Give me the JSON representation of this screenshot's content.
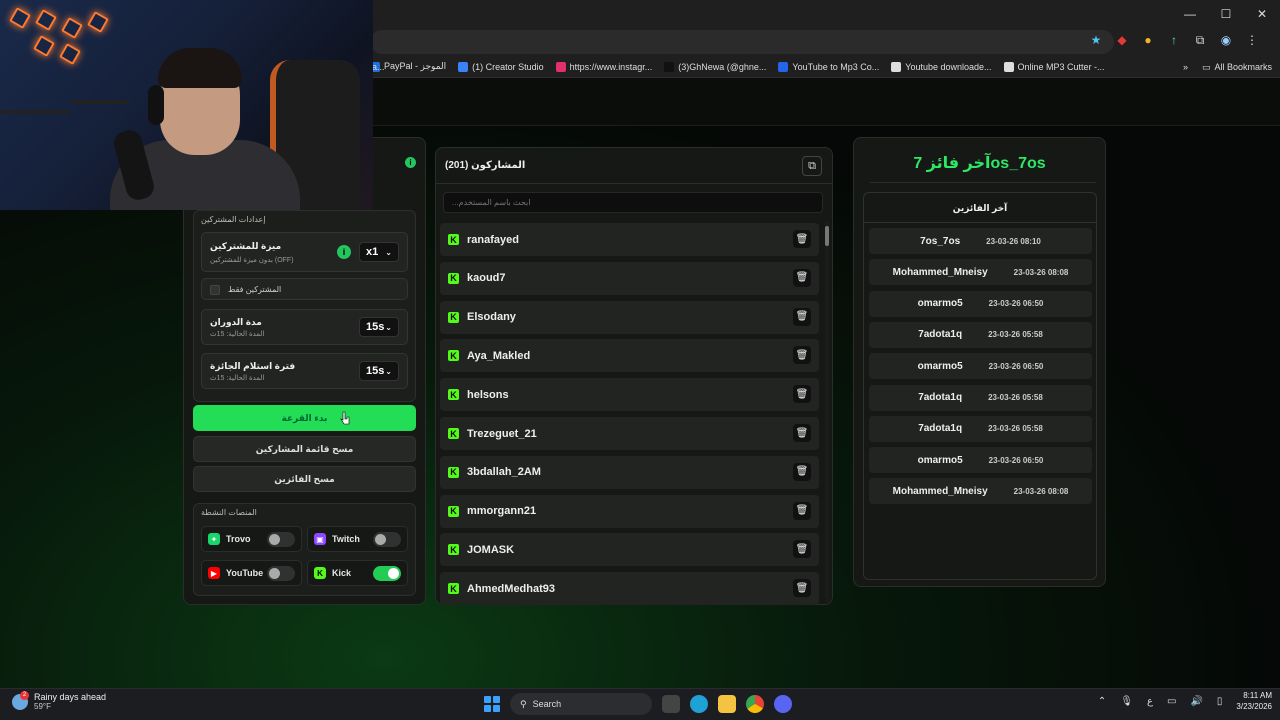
{
  "browser": {
    "window_controls": {
      "minimize": "—",
      "maximize": "☐",
      "close": "✕"
    },
    "bookmarks": [
      {
        "label": "PayPal - الموجز",
        "color": "#1e6fd9"
      },
      {
        "label": "(1) Creator Studio",
        "color": "#3b82f6"
      },
      {
        "label": "https://www.instagr...",
        "color": "#e1306c"
      },
      {
        "label": "(3)GhNewa (@ghne...",
        "color": "#111111"
      },
      {
        "label": "YouTube to Mp3 Co...",
        "color": "#2563eb"
      },
      {
        "label": "Youtube downloade...",
        "color": "#dddddd"
      },
      {
        "label": "Online MP3 Cutter -...",
        "color": "#dddddd"
      }
    ],
    "bookmarks_more": "»",
    "all_bookmarks": "All Bookmarks",
    "prefix_truncated": "a..."
  },
  "settings": {
    "title": "إعدادات المشتركين",
    "subscriber_bonus": {
      "title": "ميزة للمشتركين",
      "subtitle": "بدون ميزة للمشتركين (OFF)",
      "value": "x1"
    },
    "subscribers_only": "المشتركين فقط",
    "spin_duration": {
      "title": "مدة الدوران",
      "subtitle": "المدة الحالية: 15ث",
      "value": "15s"
    },
    "claim_period": {
      "title": "فترة استلام الجائزة",
      "subtitle": "المدة الحالية: 15ث",
      "value": "15s"
    }
  },
  "buttons": {
    "start_draw": "بدء القرعة",
    "clear_participants": "مسح قائمة المشاركين",
    "clear_winners": "مسح الفائزين"
  },
  "platforms": {
    "title": "المنصات النشطة",
    "items": [
      {
        "name": "Trovo",
        "enabled": false,
        "color": "#19d66b"
      },
      {
        "name": "Twitch",
        "enabled": false,
        "color": "#9146ff"
      },
      {
        "name": "YouTube",
        "enabled": false,
        "color": "#ff0000"
      },
      {
        "name": "Kick",
        "enabled": true,
        "color": "#53fc18"
      }
    ]
  },
  "participants": {
    "title": "المشاركون (201)",
    "search_placeholder": "...ابحث باسم المستخدم",
    "list": [
      "ranafayed",
      "kaoud7",
      "Elsodany",
      "Aya_Makled",
      "helsons",
      "Trezeguet_21",
      "3bdallah_2AM",
      "mmorgann21",
      "JOMASK",
      "AhmedMedhat93"
    ]
  },
  "winners": {
    "last_winner": "آخر فائز 7os_7os",
    "list_title": "آخر الفائزين",
    "list": [
      {
        "name": "7os_7os",
        "date": "23-03-26 08:10"
      },
      {
        "name": "Mohammed_Mneisy",
        "date": "23-03-26 08:08"
      },
      {
        "name": "omarmo5",
        "date": "23-03-26 06:50"
      },
      {
        "name": "7adota1q",
        "date": "23-03-26 05:58"
      },
      {
        "name": "omarmo5",
        "date": "23-03-26 06:50"
      },
      {
        "name": "7adota1q",
        "date": "23-03-26 05:58"
      },
      {
        "name": "7adota1q",
        "date": "23-03-26 05:58"
      },
      {
        "name": "omarmo5",
        "date": "23-03-26 06:50"
      },
      {
        "name": "Mohammed_Mneisy",
        "date": "23-03-26 08:08"
      }
    ]
  },
  "taskbar": {
    "weather_title": "Rainy days ahead",
    "weather_temp": "59°F",
    "weather_badge": "2",
    "search": "Search",
    "ime": "ع",
    "time": "8:11 AM",
    "date": "3/23/2026"
  }
}
